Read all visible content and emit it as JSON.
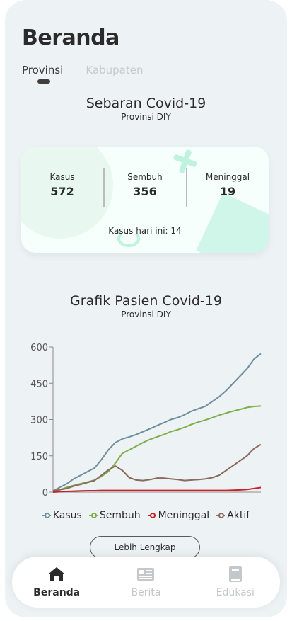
{
  "header": {
    "title": "Beranda"
  },
  "tabs": [
    {
      "label": "Provinsi",
      "active": true
    },
    {
      "label": "Kabupaten",
      "active": false
    }
  ],
  "summary": {
    "title": "Sebaran Covid-19",
    "subtitle": "Provinsi DIY",
    "stats": [
      {
        "label": "Kasus",
        "value": "572"
      },
      {
        "label": "Sembuh",
        "value": "356"
      },
      {
        "label": "Meninggal",
        "value": "19"
      }
    ],
    "today": "Kasus hari ini: 14"
  },
  "chart_section": {
    "title": "Grafik Pasien Covid-19",
    "subtitle": "Provinsi DIY",
    "more_button": "Lebih Lengkap"
  },
  "chart_data": {
    "type": "line",
    "x": [
      0,
      1,
      2,
      3,
      4,
      5,
      6,
      7,
      8,
      9,
      10,
      11,
      12,
      13,
      14,
      15,
      16,
      17,
      18,
      19,
      20,
      21,
      22,
      23,
      24,
      25,
      26,
      27,
      28,
      29,
      30
    ],
    "ylim": [
      0,
      600
    ],
    "yticks": [
      "0",
      "150",
      "300",
      "450",
      "600"
    ],
    "grid": false,
    "legend_position": "bottom",
    "series": [
      {
        "name": "Kasus",
        "color": "#6f8ea0",
        "values": [
          5,
          20,
          35,
          55,
          70,
          85,
          100,
          135,
          175,
          205,
          220,
          228,
          238,
          250,
          262,
          275,
          287,
          300,
          308,
          320,
          335,
          345,
          355,
          375,
          395,
          420,
          450,
          480,
          510,
          550,
          572
        ]
      },
      {
        "name": "Sembuh",
        "color": "#7fae4d",
        "values": [
          0,
          10,
          20,
          28,
          35,
          42,
          50,
          65,
          85,
          120,
          160,
          175,
          190,
          205,
          218,
          228,
          238,
          250,
          258,
          268,
          280,
          290,
          298,
          308,
          318,
          327,
          335,
          342,
          350,
          354,
          356
        ]
      },
      {
        "name": "Meninggal",
        "color": "#cf1f26",
        "values": [
          0,
          2,
          3,
          4,
          5,
          6,
          6,
          7,
          7,
          7,
          7,
          7,
          7,
          7,
          7,
          7,
          7,
          7,
          7,
          7,
          7,
          7,
          7,
          7,
          7,
          7,
          8,
          9,
          11,
          15,
          19
        ]
      },
      {
        "name": "Aktif",
        "color": "#8a6a5e",
        "values": [
          5,
          10,
          15,
          25,
          32,
          40,
          48,
          70,
          92,
          108,
          90,
          60,
          50,
          48,
          52,
          58,
          58,
          55,
          52,
          48,
          50,
          52,
          55,
          60,
          70,
          90,
          110,
          130,
          150,
          180,
          197
        ]
      }
    ]
  },
  "nav": [
    {
      "label": "Beranda",
      "icon": "home-icon",
      "active": true
    },
    {
      "label": "Berita",
      "icon": "newspaper-icon",
      "active": false
    },
    {
      "label": "Edukasi",
      "icon": "book-icon",
      "active": false
    }
  ]
}
